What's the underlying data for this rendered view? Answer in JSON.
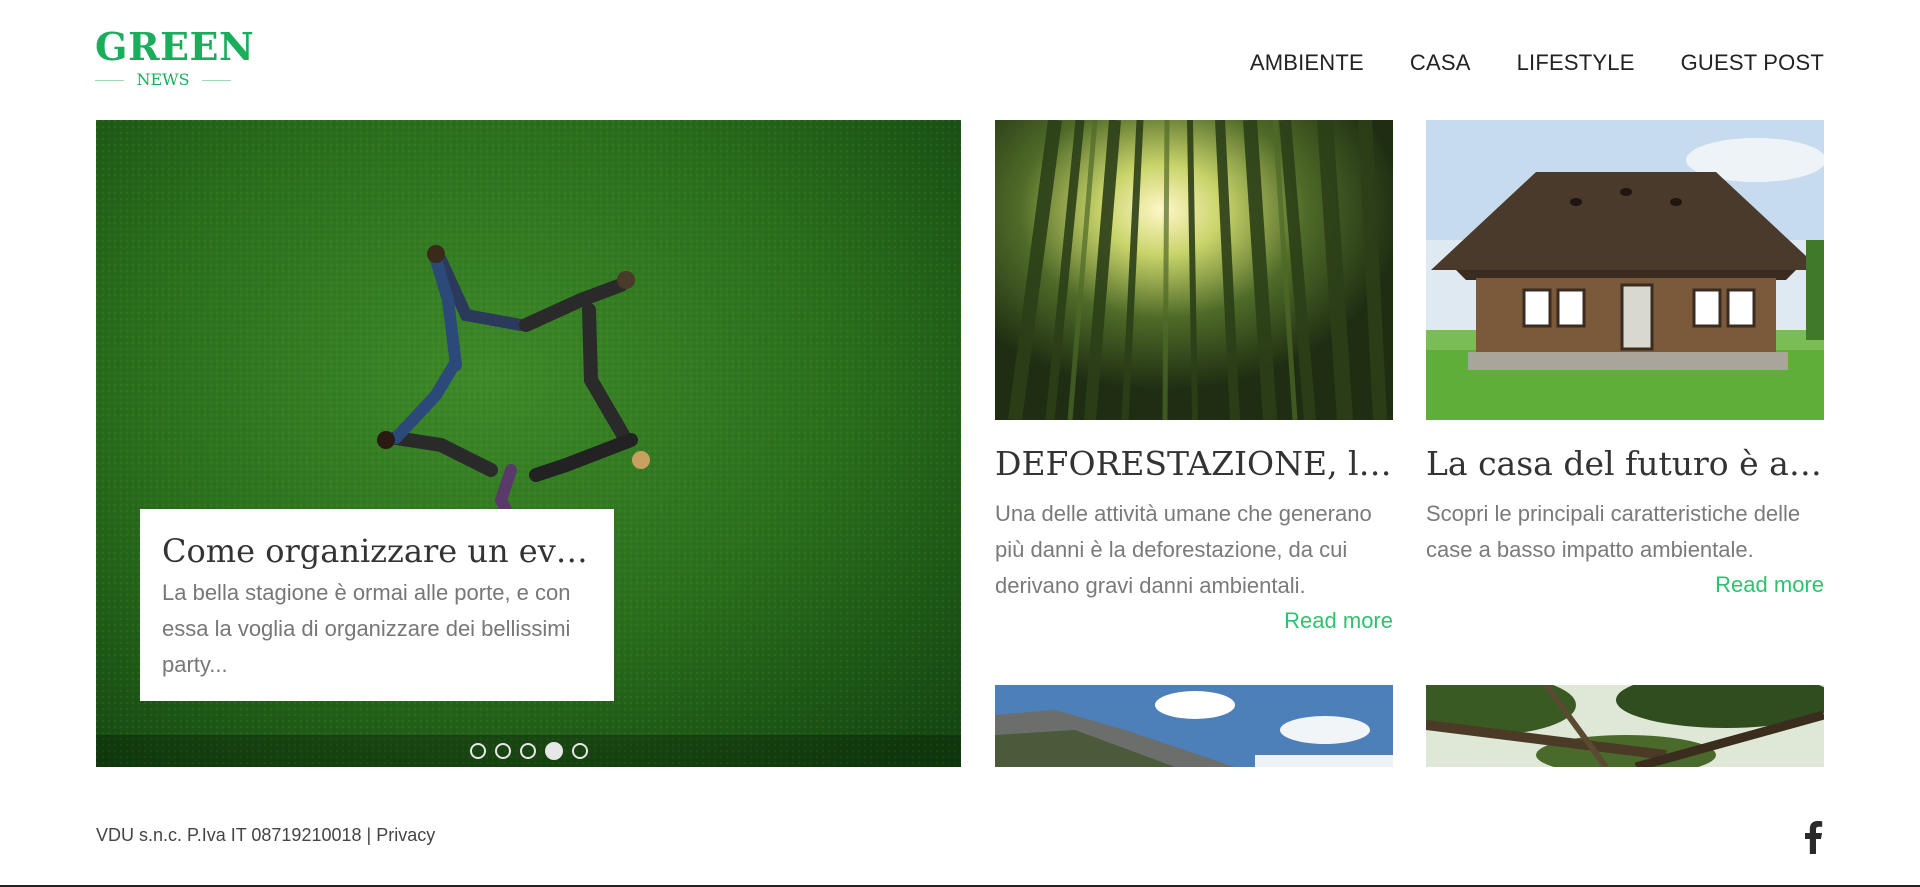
{
  "logo": {
    "main": "GREEN",
    "sub": "NEWS",
    "color": "#1aae5c"
  },
  "nav": {
    "items": [
      {
        "label": "AMBIENTE"
      },
      {
        "label": "CASA"
      },
      {
        "label": "LIFESTYLE"
      },
      {
        "label": "GUEST POST"
      }
    ]
  },
  "hero": {
    "title": "Come organizzare un evento",
    "excerpt": "La bella stagione è ormai alle porte, e con essa la voglia di organizzare dei bellissimi party...",
    "slides_count": 5,
    "active_slide": 4
  },
  "cards": [
    {
      "title": "DEFORESTAZIONE, la soluzione",
      "excerpt": "Una delle attività umane che generano più danni è la deforestazione, da cui derivano gravi danni ambientali.",
      "read_more": "Read more"
    },
    {
      "title": "La casa del futuro è a basso impatto",
      "excerpt": "Scopri le principali caratteristiche delle case a basso impatto ambientale.",
      "read_more": "Read more"
    }
  ],
  "footer": {
    "company": "VDU s.n.c. P.Iva IT 08719210018 |",
    "privacy": "Privacy",
    "social_icon": "facebook-icon"
  },
  "colors": {
    "accent": "#2ec26f",
    "brand": "#1aae5c"
  }
}
